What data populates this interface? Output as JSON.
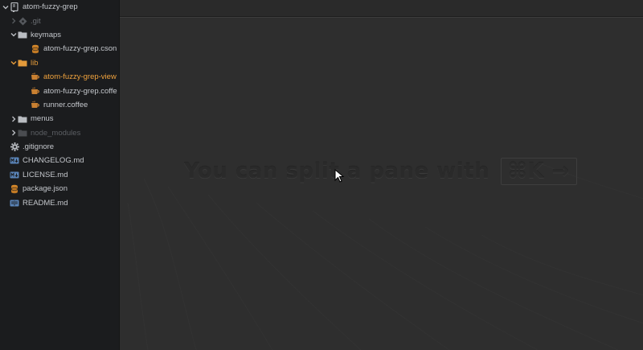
{
  "tree": {
    "root": {
      "label": "atom-fuzzy-grep",
      "icon": "repo-icon"
    },
    "items": [
      {
        "label": ".git",
        "type": "dir",
        "expanded": false,
        "depth": 1,
        "icon": "git-icon",
        "state": "dim"
      },
      {
        "label": "keymaps",
        "type": "dir",
        "expanded": true,
        "depth": 1,
        "icon": "folder-icon",
        "state": "normal"
      },
      {
        "label": "atom-fuzzy-grep.cson",
        "type": "file",
        "depth": 2,
        "icon": "database-file-icon",
        "state": "normal"
      },
      {
        "label": "lib",
        "type": "dir",
        "expanded": true,
        "depth": 1,
        "icon": "folder-icon",
        "state": "highlight"
      },
      {
        "label": "atom-fuzzy-grep-view",
        "type": "file",
        "depth": 2,
        "icon": "coffee-file-icon",
        "state": "selected"
      },
      {
        "label": "atom-fuzzy-grep.coffe",
        "type": "file",
        "depth": 2,
        "icon": "coffee-file-icon",
        "state": "normal"
      },
      {
        "label": "runner.coffee",
        "type": "file",
        "depth": 2,
        "icon": "coffee-file-icon",
        "state": "normal"
      },
      {
        "label": "menus",
        "type": "dir",
        "expanded": false,
        "depth": 1,
        "icon": "folder-icon",
        "state": "normal"
      },
      {
        "label": "node_modules",
        "type": "dir",
        "expanded": false,
        "depth": 1,
        "icon": "folder-icon",
        "state": "ignored"
      },
      {
        "label": ".gitignore",
        "type": "file",
        "depth": 1,
        "icon": "gear-icon",
        "state": "normal"
      },
      {
        "label": "CHANGELOG.md",
        "type": "file",
        "depth": 1,
        "icon": "markdown-icon",
        "state": "normal"
      },
      {
        "label": "LICENSE.md",
        "type": "file",
        "depth": 1,
        "icon": "markdown-icon",
        "state": "normal"
      },
      {
        "label": "package.json",
        "type": "file",
        "depth": 1,
        "icon": "database-file-icon",
        "state": "normal"
      },
      {
        "label": "README.md",
        "type": "file",
        "depth": 1,
        "icon": "book-icon",
        "state": "normal"
      }
    ]
  },
  "editor": {
    "hint_text": "You can split a pane with",
    "hint_keys": "⌘K →"
  },
  "colors": {
    "sidebar_bg": "#1b1c1e",
    "editor_bg": "#2e2e2e",
    "highlight": "#e39a3a",
    "file_text": "#c4c7cc",
    "dim_text": "#6a6d72"
  }
}
